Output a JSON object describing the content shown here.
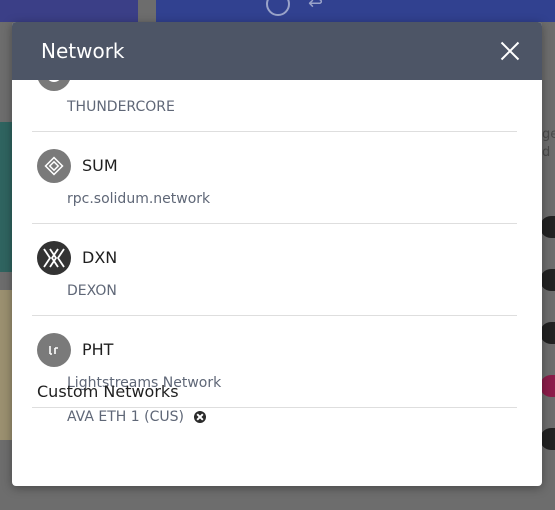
{
  "modal": {
    "title": "Network"
  },
  "networks": [
    {
      "name": "",
      "subtitle": "THUNDERCORE",
      "icon": "thundercore-icon"
    },
    {
      "name": "SUM",
      "subtitle": "rpc.solidum.network",
      "icon": "solidum-icon"
    },
    {
      "name": "DXN",
      "subtitle": "DEXON",
      "icon": "dexon-icon"
    },
    {
      "name": "PHT",
      "subtitle": "Lightstreams Network",
      "icon": "lightstreams-icon"
    }
  ],
  "custom": {
    "title": "Custom Networks",
    "items": [
      {
        "label": "AVA ETH 1 (CUS)"
      }
    ]
  },
  "colors": {
    "header": "#4d5566",
    "icon_bg": "#7a7a7a",
    "subtitle": "#5f6777"
  }
}
